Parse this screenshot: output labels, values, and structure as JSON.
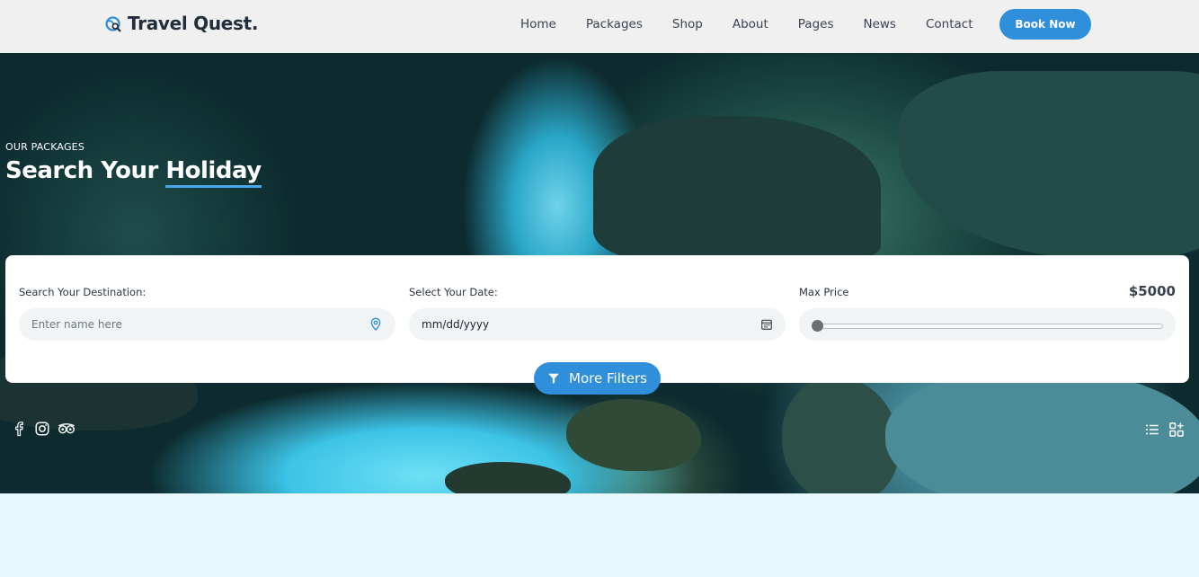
{
  "header": {
    "brand": "Travel Quest.",
    "nav": [
      "Home",
      "Packages",
      "Shop",
      "About",
      "Pages",
      "News",
      "Contact"
    ],
    "cta": "Book Now"
  },
  "hero": {
    "eyebrow": "OUR PACKAGES",
    "title_start": "Search Your ",
    "title_highlight": "Holiday"
  },
  "search": {
    "destination_label": "Search Your Destination:",
    "destination_placeholder": "Enter name here",
    "date_label": "Select Your Date:",
    "date_value": "mm/dd/yyyy",
    "price_label": "Max Price",
    "price_value": "$5000",
    "price_slider_fraction": 0,
    "more_filters": "More Filters"
  },
  "colors": {
    "accent": "#2f8fdb",
    "header_bg": "#f0f0f0",
    "below_bg": "#e6f7fd"
  },
  "icons": {
    "social": [
      "facebook-icon",
      "instagram-icon",
      "tripadvisor-icon"
    ],
    "tools": [
      "list-view-icon",
      "grid-add-icon"
    ]
  }
}
